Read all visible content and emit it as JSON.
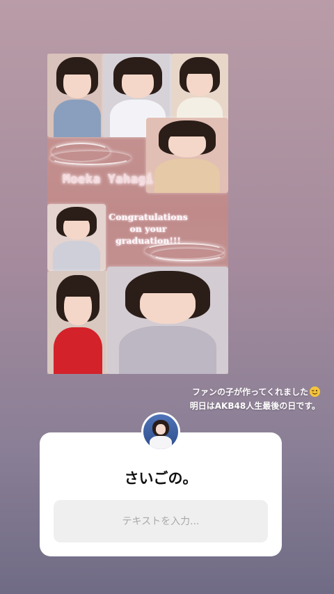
{
  "story": {
    "collage": {
      "name_text": "Moeka Yahagi",
      "message_lines": [
        "Congratulations",
        "on your",
        "graduation!!!"
      ]
    },
    "caption": {
      "line1": "ファンの子が作ってくれました",
      "line1_emoji": "winking-face-emoji",
      "line2": "明日はAKB48人生最後の日です。"
    }
  },
  "question_sticker": {
    "question": "さいごの。",
    "input_placeholder": "テキストを入力..."
  },
  "colors": {
    "background_top": "#b99ca7",
    "background_bottom": "#706b85",
    "card": "#ffffff",
    "input_bg": "#efefef"
  }
}
